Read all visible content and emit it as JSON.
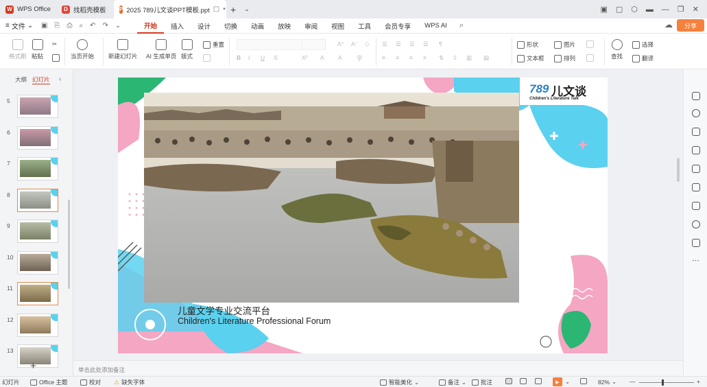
{
  "tabs": {
    "home": "WPS Office",
    "tab1": "找稻壳模板",
    "tab2": "2025 789儿文谈PPT模板.ppt",
    "new_tab": "+"
  },
  "menubar": {
    "file": "文件",
    "items": [
      "开始",
      "插入",
      "设计",
      "切换",
      "动画",
      "放映",
      "审阅",
      "视图",
      "工具",
      "会员专享",
      "WPS AI"
    ],
    "active_index": 0,
    "share": "分享"
  },
  "ribbon": {
    "format_painter": "格式刷",
    "paste": "粘贴",
    "play_from_current": "当页开始",
    "new_slide": "新建幻灯片",
    "ai_slide": "AI 生成单页",
    "layout": "版式",
    "reset": "重置",
    "shape": "形状",
    "picture": "图片",
    "textbox": "文本框",
    "arrange": "排列",
    "find": "查找",
    "select": "选择",
    "translate": "翻译"
  },
  "left_panel": {
    "tab_outline": "大纲",
    "tab_slides": "幻灯片",
    "slide_numbers": [
      "5",
      "6",
      "7",
      "8",
      "9",
      "10",
      "11",
      "12",
      "13"
    ],
    "selected": [
      "8",
      "11"
    ],
    "add": "+"
  },
  "slide": {
    "logo_number": "789",
    "logo_chinese": "儿文谈",
    "logo_english": "Children's Literature Talk",
    "title_cn": "儿童文学专业交流平台",
    "title_en": "Children's Literature Professional Forum"
  },
  "notes": {
    "placeholder": "单击此处添加备注"
  },
  "statusbar": {
    "slide_label": "幻灯片",
    "theme": "Office 主题",
    "proof": "校对",
    "missing_font": "缺失字体",
    "smart_beautify": "智能美化",
    "notes": "备注",
    "comments": "批注",
    "zoom": "82%"
  },
  "colors": {
    "accent_red": "#d6371f",
    "share_orange": "#f5813c",
    "slide_pink": "#f4a6c3",
    "slide_cyan": "#5ad1ee",
    "slide_green": "#2bb673"
  }
}
